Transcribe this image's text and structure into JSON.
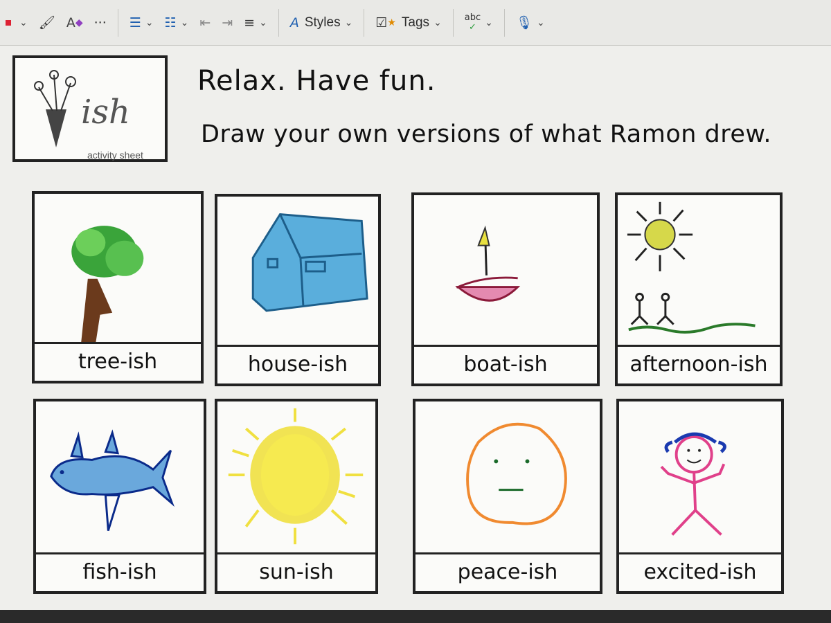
{
  "toolbar": {
    "more_label": "···",
    "styles_label": "Styles",
    "tags_label": "Tags",
    "spelling_label": "abc"
  },
  "sheet": {
    "logo_word": "ish",
    "logo_caption": "activity sheet",
    "headline": "Relax. Have fun.",
    "subhead": "Draw your own versions of what Ramon drew."
  },
  "cards": [
    {
      "label": "tree-ish"
    },
    {
      "label": "house-ish"
    },
    {
      "label": "boat-ish"
    },
    {
      "label": "afternoon-ish"
    },
    {
      "label": "fish-ish"
    },
    {
      "label": "sun-ish"
    },
    {
      "label": "peace-ish"
    },
    {
      "label": "excited-ish"
    }
  ],
  "colors": {
    "tree_leaves": "#3aa43a",
    "tree_trunk": "#6b3a1c",
    "house": "#5aaedc",
    "boat": "#e48ab0",
    "sun": "#f0e040",
    "fish": "#6aa8dc",
    "face": "#f08a30",
    "stick_figure": "#e0408a"
  }
}
